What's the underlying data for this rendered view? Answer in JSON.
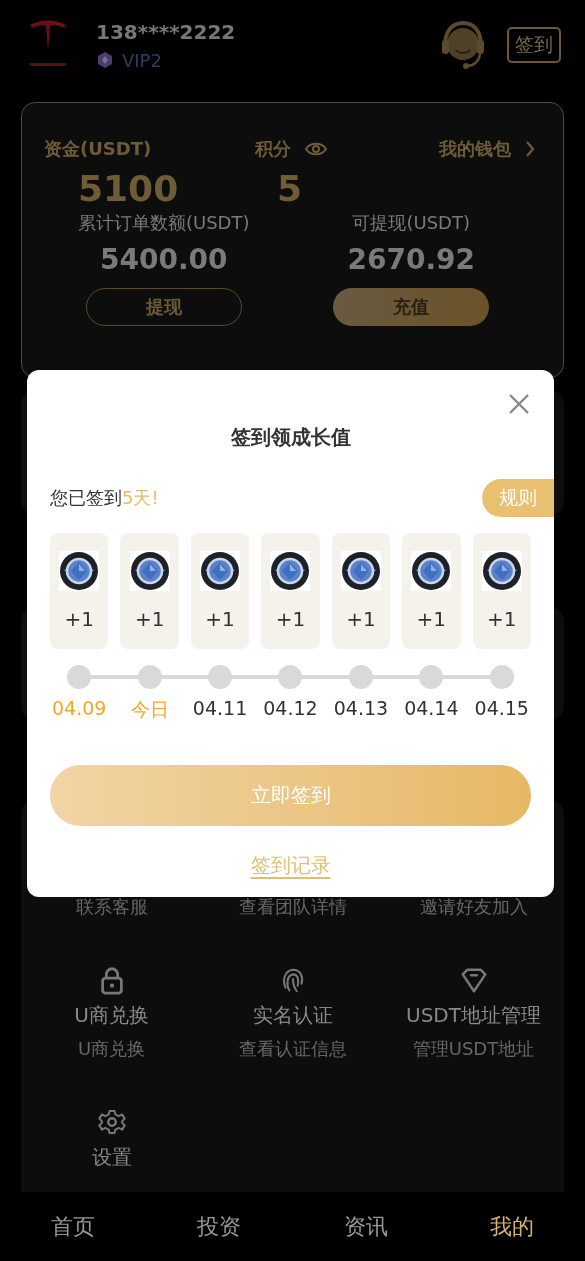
{
  "header": {
    "phone": "138****2222",
    "vip": "VIP2",
    "checkin_button": "签到"
  },
  "wallet_card": {
    "funds_label": "资金(USDT)",
    "points_label": "积分",
    "wallet_link": "我的钱包",
    "funds_value": "5100",
    "points_value": "5",
    "stats": [
      {
        "label": "累计订单数额(USDT)",
        "value": "5400.00"
      },
      {
        "label": "可提现(USDT)",
        "value": "2670.92"
      }
    ],
    "buttons": [
      {
        "label": "提现",
        "kind": "outline"
      },
      {
        "label": "充值",
        "kind": "filled"
      }
    ]
  },
  "menu_grid": [
    {
      "subtitle": "联系客服"
    },
    {
      "subtitle": "查看团队详情"
    },
    {
      "subtitle": "邀请好友加入"
    },
    {
      "kind": "lock",
      "title": "U商兑换",
      "subtitle": "U商兑换"
    },
    {
      "kind": "fingerprint",
      "title": "实名认证",
      "subtitle": "查看认证信息"
    },
    {
      "kind": "diamond",
      "title": "USDT地址管理",
      "subtitle": "管理USDT地址"
    },
    {
      "kind": "gear",
      "title": "设置"
    }
  ],
  "checkin_dialog": {
    "title": "签到领成长值",
    "status_text": "您已签到",
    "status_days": "5天!",
    "rules_button": "规则",
    "days": [
      {
        "reward": "+1",
        "date": "04.09",
        "signed": true
      },
      {
        "reward": "+1",
        "date": "今日",
        "signed": true
      },
      {
        "reward": "+1",
        "date": "04.11",
        "signed": false
      },
      {
        "reward": "+1",
        "date": "04.12",
        "signed": false
      },
      {
        "reward": "+1",
        "date": "04.13",
        "signed": false
      },
      {
        "reward": "+1",
        "date": "04.14",
        "signed": false
      },
      {
        "reward": "+1",
        "date": "04.15",
        "signed": false
      }
    ],
    "checkin_button": "立即签到",
    "history_link": "签到记录"
  },
  "tab_bar": [
    {
      "label": "首页",
      "selected": false
    },
    {
      "label": "投资",
      "selected": false
    },
    {
      "label": "资讯",
      "selected": false
    },
    {
      "label": "我的",
      "selected": true
    }
  ]
}
